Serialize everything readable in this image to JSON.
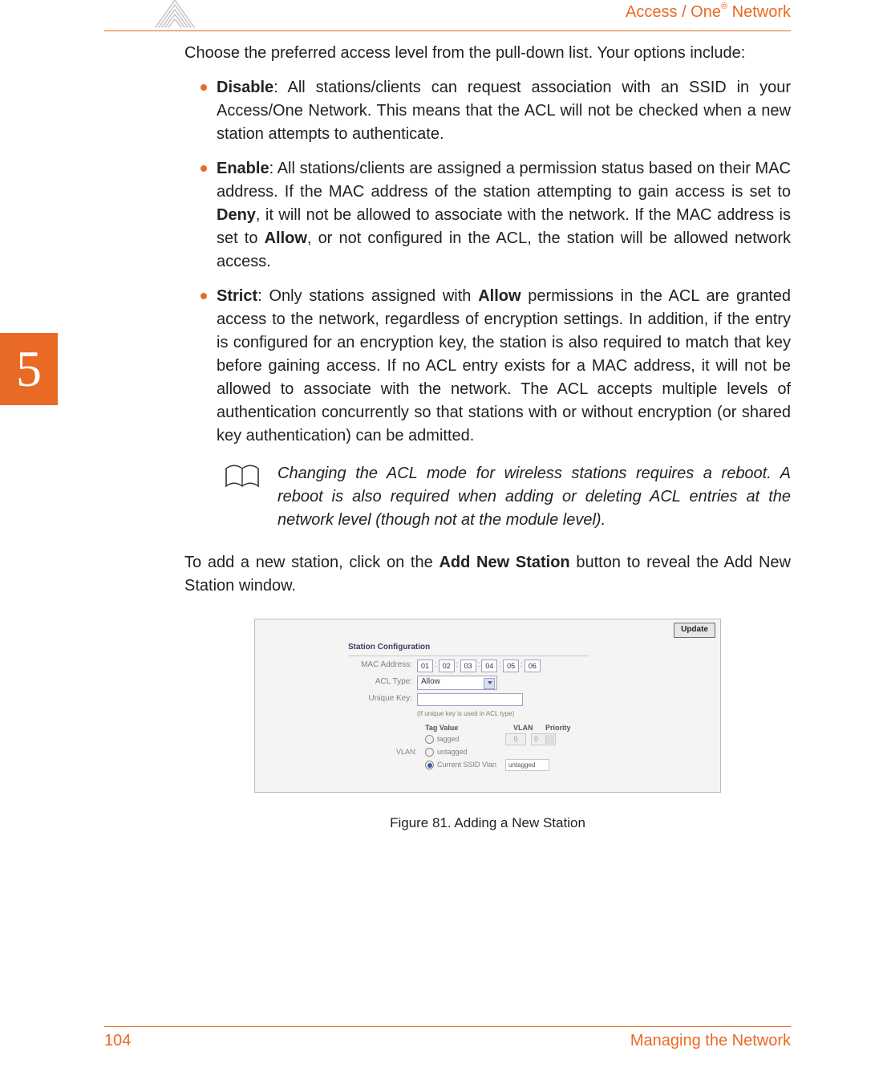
{
  "header": {
    "brand_pre": "Access / One",
    "brand_reg": "®",
    "brand_post": " Network"
  },
  "content": {
    "intro": "Choose the preferred access level from the pull-down list. Your options include:",
    "bullets": {
      "disable": {
        "title": "Disable",
        "text": ": All stations/clients can request association with an SSID in your Access/One Network. This means that the ACL will not be checked when a new station attempts to authenticate."
      },
      "enable": {
        "title": "Enable",
        "pre": ": All stations/clients are assigned a permission status based on their MAC address. If the MAC address of the station attempting to gain access is set to ",
        "deny": "Deny",
        "mid": ", it will not be allowed to associate with the network. If the MAC address is set to ",
        "allow": "Allow",
        "post": ", or not configured in the ACL, the station will be allowed network access."
      },
      "strict": {
        "title": "Strict",
        "pre": ": Only stations assigned with ",
        "allow": "Allow",
        "post": " permissions in the ACL are granted access to the network, regardless of encryption settings. In addition, if the entry is configured for an encryption key, the station is also required to match that key before gaining access. If no ACL entry exists for a MAC address, it will not be allowed to associate with the network. The ACL accepts multiple levels of authentication concurrently so that stations with or without encryption (or shared key authentication) can be admitted."
      }
    },
    "note": "Changing the ACL mode for wireless stations requires a reboot. A reboot is also required when adding or deleting ACL entries at the network level (though not at the module level).",
    "after_pre": "To add a new station, click on the ",
    "after_btn": "Add New Station",
    "after_post": " button to reveal the Add New Station window.",
    "figure_caption": "Figure 81. Adding a New Station"
  },
  "figure": {
    "update": "Update",
    "panel_title": "Station Configuration",
    "mac_label": "MAC Address:",
    "mac": [
      "01",
      "02",
      "03",
      "04",
      "05",
      "06"
    ],
    "acl_label": "ACL Type:",
    "acl_value": "Allow",
    "key_label": "Unique Key:",
    "key_hint": "(If unique key is used in ACL type)",
    "vlan_label": "VLAN:",
    "cols": {
      "tag": "Tag Value",
      "vlan": "VLAN",
      "pri": "Priority"
    },
    "opts": {
      "tagged": "tagged",
      "untagged": "untagged",
      "ssid": "Current SSID Vlan"
    },
    "vlan_num": "0",
    "pri_num": "0",
    "ssid_val": "untagged"
  },
  "chapter": "5",
  "footer": {
    "page": "104",
    "section": "Managing the Network"
  }
}
